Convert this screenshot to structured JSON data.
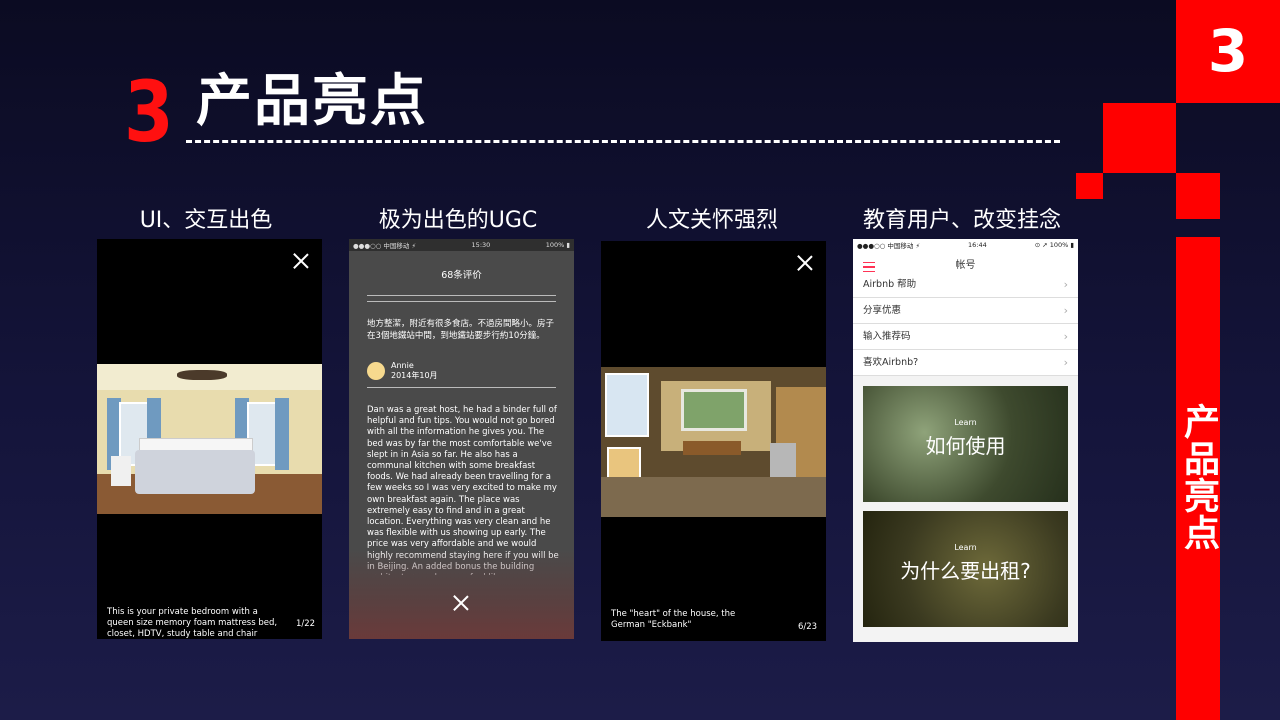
{
  "header": {
    "number": "3",
    "title": "产品亮点"
  },
  "side": {
    "badge_number": "3",
    "vertical_label": "产品亮点"
  },
  "columns": [
    {
      "title": "UI、交互出色"
    },
    {
      "title": "极为出色的UGC"
    },
    {
      "title": "人文关怀强烈"
    },
    {
      "title": "教育用户、改变挂念"
    }
  ],
  "screen1": {
    "caption": "This is your private bedroom with a queen size memory foam mattress bed, closet, HDTV, study table and chair",
    "counter": "1/22"
  },
  "screen2": {
    "status_carrier": "●●●○○ 中国移动 ⚡",
    "status_time": "15:30",
    "status_battery": "100% ▮",
    "title": "68条评价",
    "review_cn": "地方整潔，附近有很多食店。不過房間略小。房子在3個地鐵站中間，到地鐵站要步行約10分鐘。",
    "reviewer_name": "Annie",
    "reviewer_date": "2014年10月",
    "review_en": "Dan was a great host, he had a binder full of helpful and fun tips. You would not go bored with all the information he gives you. The bed was by far the most comfortable we've slept in in Asia so far. He also has a communal kitchen with some breakfast foods. We had already been travelling for a few weeks so I was very excited to make my own breakfast again. The place was extremely easy to find and in a great location. Everything was very clean and he was flexible with us showing up early. The price was very affordable and we would highly recommend staying here if you will be in Beijing. An added bonus the building architecture makes you feel like you are really"
  },
  "screen3": {
    "caption": "The \"heart\" of the house, the German \"Eckbank\"",
    "counter": "6/23"
  },
  "screen4": {
    "status_carrier": "●●●○○ 中国移动 ⚡",
    "status_time": "16:44",
    "status_battery": "⊙ ➚ 100% ▮",
    "header_title": "帐号",
    "items": [
      {
        "label": "Airbnb 帮助"
      },
      {
        "label": "分享优惠"
      },
      {
        "label": "输入推荐码"
      },
      {
        "label": "喜欢Airbnb?"
      }
    ],
    "chevron": "›",
    "cards": [
      {
        "small": "Learn",
        "big": "如何使用"
      },
      {
        "small": "Learn",
        "big": "为什么要出租?"
      }
    ]
  },
  "colors": {
    "accent": "#ff0000",
    "bg_top": "#0b0b22",
    "bg_bottom": "#1c1c48"
  }
}
